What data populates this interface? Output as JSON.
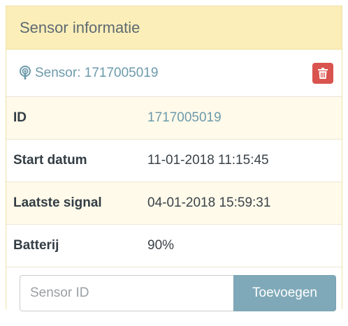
{
  "panel": {
    "heading": "Sensor informatie"
  },
  "sensor": {
    "title": "Sensor: 1717005019",
    "delete_icon": "trash-icon",
    "title_icon": "podcast-icon"
  },
  "info": {
    "id_label": "ID",
    "id_value": "1717005019",
    "start_label": "Start datum",
    "start_value": "11-01-2018 11:15:45",
    "last_label": "Laatste signal",
    "last_value": "04-01-2018 15:59:31",
    "battery_label": "Batterij",
    "battery_value": "90%"
  },
  "form": {
    "input_placeholder": "Sensor ID",
    "input_value": "",
    "add_label": "Toevoegen"
  },
  "colors": {
    "heading_bg": "#fbeeb8",
    "accent": "#6c9aaa",
    "danger": "#d9534f",
    "button": "#7fa9b8"
  }
}
